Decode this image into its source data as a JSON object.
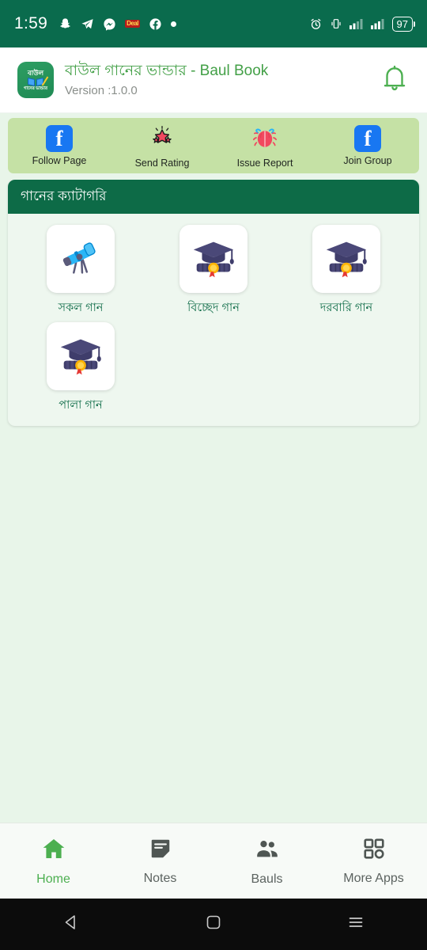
{
  "status_bar": {
    "time": "1:59",
    "notification_icons": [
      "snapchat-icon",
      "telegram-icon",
      "messenger-icon",
      "deal-badge-icon",
      "facebook-icon",
      "dot-icon"
    ],
    "deal_badge_text": "Deal",
    "right_icons": [
      "alarm-icon",
      "vibrate-icon",
      "signal-1-icon",
      "signal-2-icon"
    ],
    "battery_level": "97",
    "background_color": "#0a6b4d"
  },
  "app_bar": {
    "logo_top_text": "বাউল",
    "logo_bottom_text": "গানের ভান্ডার",
    "title": "বাউল গানের ভান্ডার - Baul Book",
    "version": "Version :1.0.0",
    "title_color": "#43a047",
    "notification_icon": "bell-icon"
  },
  "quick_actions": {
    "background_color": "#c5e1a5",
    "items": [
      {
        "label": "Follow Page",
        "icon": "facebook-icon"
      },
      {
        "label": "Send Rating",
        "icon": "stars-icon"
      },
      {
        "label": "Issue Report",
        "icon": "bug-icon"
      },
      {
        "label": "Join Group",
        "icon": "facebook-icon"
      }
    ]
  },
  "category_section": {
    "header": "গানের ক্যাটাগরি",
    "header_color": "#0d6b47",
    "items": [
      {
        "label": "সকল গান",
        "icon": "telescope-icon"
      },
      {
        "label": "বিচ্ছেদ গান",
        "icon": "graduation-cap-icon"
      },
      {
        "label": "দরবারি গান",
        "icon": "graduation-cap-icon"
      },
      {
        "label": "পালা গান",
        "icon": "graduation-cap-icon"
      }
    ]
  },
  "bottom_nav": {
    "active_color": "#4caf50",
    "items": [
      {
        "label": "Home",
        "icon": "home-icon",
        "active": true
      },
      {
        "label": "Notes",
        "icon": "notes-icon",
        "active": false
      },
      {
        "label": "Bauls",
        "icon": "people-icon",
        "active": false
      },
      {
        "label": "More Apps",
        "icon": "grid-apps-icon",
        "active": false
      }
    ]
  },
  "system_nav": {
    "back": "back-triangle-icon",
    "home": "home-square-icon",
    "recents": "recents-menu-icon"
  }
}
